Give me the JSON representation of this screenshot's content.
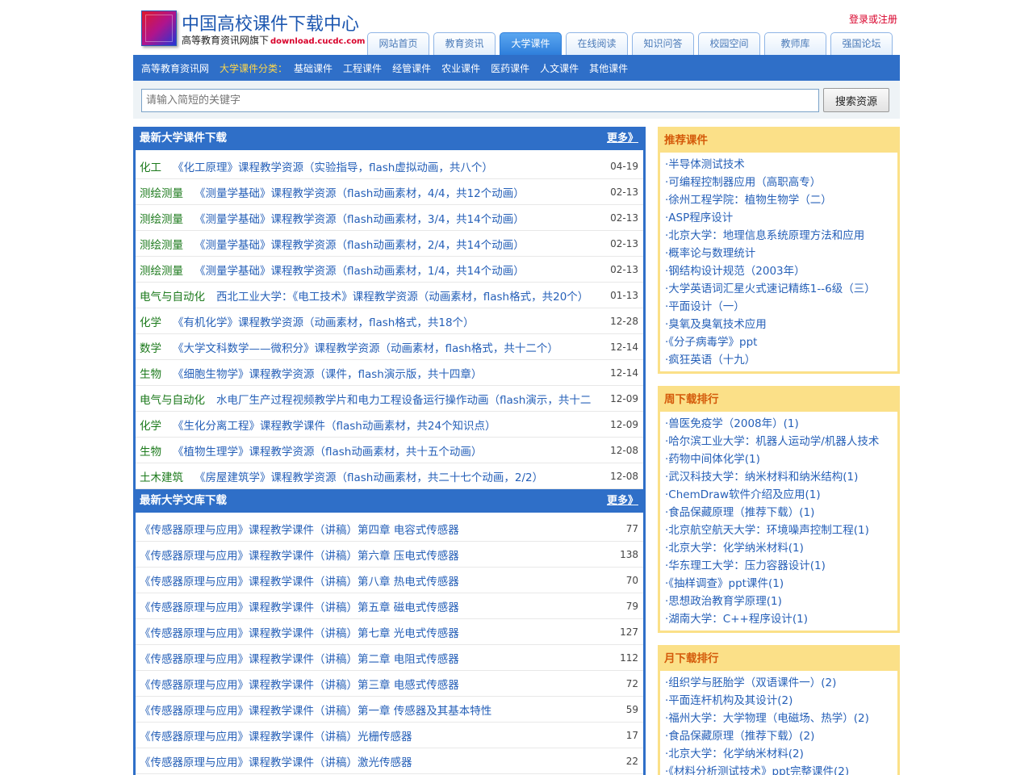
{
  "header": {
    "title": "中国高校课件下载中心",
    "subtitle": "高等教育资讯网旗下",
    "domain": "download.cucdc.com",
    "login": "登录或注册",
    "nav": [
      "网站首页",
      "教育资讯",
      "大学课件",
      "在线阅读",
      "知识问答",
      "校园空间",
      "教师库",
      "强国论坛"
    ],
    "active_nav": "大学课件"
  },
  "subnav": {
    "home": "高等教育资讯网",
    "label": "大学课件分类：",
    "items": [
      "基础课件",
      "工程课件",
      "经管课件",
      "农业课件",
      "医药课件",
      "人文课件",
      "其他课件"
    ]
  },
  "search": {
    "placeholder": "请输入简短的关键字",
    "button": "搜索资源"
  },
  "latest_courseware": {
    "title": "最新大学课件下载",
    "more": "更多》",
    "items": [
      {
        "cat": "化工",
        "title": "《化工原理》课程教学资源（实验指导，flash虚拟动画，共八个）",
        "date": "04-19"
      },
      {
        "cat": "测绘测量",
        "title": "《测量学基础》课程教学资源（flash动画素材，4/4，共12个动画）",
        "date": "02-13"
      },
      {
        "cat": "测绘测量",
        "title": "《测量学基础》课程教学资源（flash动画素材，3/4，共14个动画）",
        "date": "02-13"
      },
      {
        "cat": "测绘测量",
        "title": "《测量学基础》课程教学资源（flash动画素材，2/4，共14个动画）",
        "date": "02-13"
      },
      {
        "cat": "测绘测量",
        "title": "《测量学基础》课程教学资源（flash动画素材，1/4，共14个动画）",
        "date": "02-13"
      },
      {
        "cat": "电气与自动化",
        "title": "西北工业大学：《电工技术》课程教学资源（动画素材，flash格式，共20个）",
        "date": "01-13"
      },
      {
        "cat": "化学",
        "title": "《有机化学》课程教学资源（动画素材，flash格式，共18个）",
        "date": "12-28"
      },
      {
        "cat": "数学",
        "title": "《大学文科数学——微积分》课程教学资源（动画素材，flash格式，共十二个）",
        "date": "12-14"
      },
      {
        "cat": "生物",
        "title": "《细胞生物学》课程教学资源（课件，flash演示版，共十四章）",
        "date": "12-14"
      },
      {
        "cat": "电气与自动化",
        "title": "水电厂生产过程视频教学片和电力工程设备运行操作动画（flash演示，共十二",
        "date": "12-09"
      },
      {
        "cat": "化学",
        "title": "《生化分离工程》课程教学课件（flash动画素材，共24个知识点）",
        "date": "12-09"
      },
      {
        "cat": "生物",
        "title": "《植物生理学》课程教学资源（flash动画素材，共十五个动画）",
        "date": "12-08"
      },
      {
        "cat": "土木建筑",
        "title": "《房屋建筑学》课程教学资源（flash动画素材，共二十七个动画，2/2）",
        "date": "12-08"
      }
    ]
  },
  "latest_library": {
    "title": "最新大学文库下载",
    "more": "更多》",
    "items": [
      {
        "title": "《传感器原理与应用》课程教学课件（讲稿）第四章 电容式传感器",
        "count": "77"
      },
      {
        "title": "《传感器原理与应用》课程教学课件（讲稿）第六章 压电式传感器",
        "count": "138"
      },
      {
        "title": "《传感器原理与应用》课程教学课件（讲稿）第八章 热电式传感器",
        "count": "70"
      },
      {
        "title": "《传感器原理与应用》课程教学课件（讲稿）第五章 磁电式传感器",
        "count": "79"
      },
      {
        "title": "《传感器原理与应用》课程教学课件（讲稿）第七章 光电式传感器",
        "count": "127"
      },
      {
        "title": "《传感器原理与应用》课程教学课件（讲稿）第二章 电阻式传感器",
        "count": "112"
      },
      {
        "title": "《传感器原理与应用》课程教学课件（讲稿）第三章 电感式传感器",
        "count": "72"
      },
      {
        "title": "《传感器原理与应用》课程教学课件（讲稿）第一章 传感器及其基本特性",
        "count": "59"
      },
      {
        "title": "《传感器原理与应用》课程教学课件（讲稿）光栅传感器",
        "count": "17"
      },
      {
        "title": "《传感器原理与应用》课程教学课件（讲稿）激光传感器",
        "count": "22"
      }
    ]
  },
  "recommended": {
    "title": "推荐课件",
    "items": [
      "·半导体测试技术",
      "·可编程控制器应用（高职高专）",
      "·徐州工程学院：植物生物学（二）",
      "·ASP程序设计",
      "·北京大学：地理信息系统原理方法和应用",
      "·概率论与数理统计",
      "·钢结构设计规范（2003年）",
      "·大学英语词汇星火式速记精练1--6级（三）",
      "·平面设计（一）",
      "·臭氧及臭氧技术应用",
      "·《分子病毒学》ppt",
      "·疯狂英语（十九）"
    ]
  },
  "weekly": {
    "title": "周下载排行",
    "items": [
      "·兽医免疫学（2008年）(1)",
      "·哈尔滨工业大学：机器人运动学/机器人技术",
      "·药物中间体化学(1)",
      "·武汉科技大学：纳米材料和纳米结构(1)",
      "·ChemDraw软件介绍及应用(1)",
      "·食品保藏原理（推荐下载）(1)",
      "·北京航空航天大学：环境噪声控制工程(1)",
      "·北京大学：化学纳米材料(1)",
      "·华东理工大学：压力容器设计(1)",
      "·《抽样调查》ppt课件(1)",
      "·思想政治教育学原理(1)",
      "·湖南大学：C++程序设计(1)"
    ]
  },
  "monthly": {
    "title": "月下载排行",
    "items": [
      "·组织学与胚胎学（双语课件一）(2)",
      "·平面连杆机构及其设计(2)",
      "·福州大学：大学物理（电磁场、热学）(2)",
      "·食品保藏原理（推荐下载）(2)",
      "·北京大学：化学纳米材料(2)",
      "·《材料分析测试技术》ppt完整课件(2)"
    ]
  }
}
